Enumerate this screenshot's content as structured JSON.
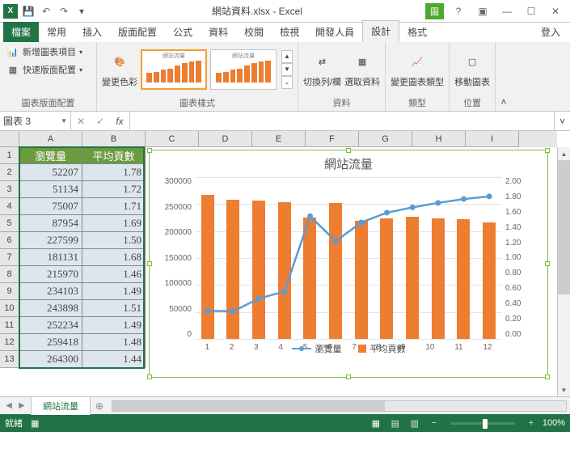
{
  "titlebar": {
    "title": "網站資料.xlsx - Excel",
    "context_tool": "圖"
  },
  "tabs": {
    "file": "檔案",
    "home": "常用",
    "insert": "插入",
    "layout": "版面配置",
    "formulas": "公式",
    "data": "資料",
    "review": "校閱",
    "view": "檢視",
    "developer": "開發人員",
    "design": "設計",
    "format": "格式",
    "login": "登入"
  },
  "ribbon": {
    "grp_layout": "圖表版面配置",
    "add_element": "新增圖表項目",
    "quick_layout": "快速版面配置",
    "grp_styles": "圖表樣式",
    "change_colors": "變更色彩",
    "grp_data": "資料",
    "switch_rc": "切換列/欄",
    "select_data": "選取資料",
    "grp_type": "類型",
    "change_type": "變更圖表類型",
    "grp_location": "位置",
    "move_chart": "移動圖表"
  },
  "namebox": "圖表 3",
  "formula_fx": "fx",
  "columns": [
    "A",
    "B",
    "C",
    "D",
    "E",
    "F",
    "G",
    "H",
    "I"
  ],
  "rows": [
    1,
    2,
    3,
    4,
    5,
    6,
    7,
    8,
    9,
    10,
    11,
    12,
    13
  ],
  "table": {
    "hdr_a": "瀏覽量",
    "hdr_b": "平均頁數",
    "data": [
      {
        "a": "52207",
        "b": "1.78"
      },
      {
        "a": "51134",
        "b": "1.72"
      },
      {
        "a": "75007",
        "b": "1.71"
      },
      {
        "a": "87954",
        "b": "1.69"
      },
      {
        "a": "227599",
        "b": "1.50"
      },
      {
        "a": "181131",
        "b": "1.68"
      },
      {
        "a": "215970",
        "b": "1.46"
      },
      {
        "a": "234103",
        "b": "1.49"
      },
      {
        "a": "243898",
        "b": "1.51"
      },
      {
        "a": "252234",
        "b": "1.49"
      },
      {
        "a": "259418",
        "b": "1.48"
      },
      {
        "a": "264300",
        "b": "1.44"
      }
    ]
  },
  "chart_data": {
    "type": "bar",
    "title": "網站流量",
    "categories": [
      1,
      2,
      3,
      4,
      5,
      6,
      7,
      8,
      9,
      10,
      11,
      12
    ],
    "series": [
      {
        "name": "瀏覽量",
        "type": "line",
        "axis": "left",
        "values": [
          52207,
          51134,
          75007,
          87954,
          227599,
          181131,
          215970,
          234103,
          243898,
          252234,
          259418,
          264300
        ]
      },
      {
        "name": "平均頁數",
        "type": "bar",
        "axis": "right",
        "values": [
          1.78,
          1.72,
          1.71,
          1.69,
          1.5,
          1.68,
          1.46,
          1.49,
          1.51,
          1.49,
          1.48,
          1.44
        ]
      }
    ],
    "y1_ticks": [
      0,
      50000,
      100000,
      150000,
      200000,
      250000,
      300000
    ],
    "y2_ticks": [
      "0.00",
      "0.20",
      "0.40",
      "0.60",
      "0.80",
      "1.00",
      "1.20",
      "1.40",
      "1.60",
      "1.80",
      "2.00"
    ],
    "y1_max": 300000,
    "y2_max": 2.0
  },
  "sheettab": "網站流量",
  "statusbar": {
    "ready": "就緒",
    "rec": "▦",
    "zoom": "100%"
  },
  "colors": {
    "excel_green": "#217346",
    "bar": "#ed7d31",
    "line": "#5b9bd5"
  }
}
